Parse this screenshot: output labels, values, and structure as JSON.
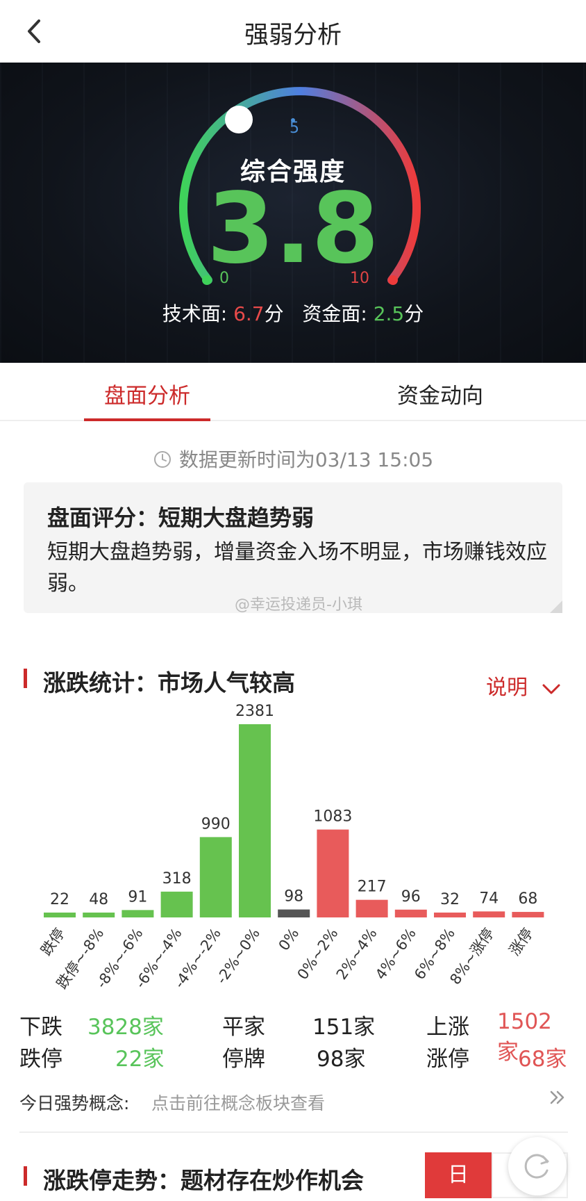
{
  "header": {
    "title": "强弱分析"
  },
  "gauge": {
    "label": "综合强度",
    "value": "3.8",
    "min_label": "0",
    "max_label": "10",
    "mid_label": "5",
    "level": 0.38,
    "technical_label": "技术面: ",
    "technical_value": "6.7",
    "funds_label": "资金面: ",
    "funds_value": "2.5",
    "unit": "分",
    "colors": {
      "low": "#3fd25a",
      "mid": "#4f7fe0",
      "high": "#ee3b3b"
    }
  },
  "tabs": [
    {
      "label": "盘面分析",
      "active": true
    },
    {
      "label": "资金动向",
      "active": false
    }
  ],
  "update": {
    "text": "数据更新时间为03/13  15:05"
  },
  "summary": {
    "title": "盘面评分：短期大盘趋势弱",
    "body": "短期大盘趋势弱，增量资金入场不明显，市场赚钱效应弱。"
  },
  "watermark": "@幸运投递员-小琪",
  "stats_section": {
    "title": "涨跌统计：市场人气较高",
    "explain_label": "说明"
  },
  "chart_data": {
    "type": "bar",
    "categories": [
      "跌停",
      "跌停~-8%",
      "-8%~-6%",
      "-6%~-4%",
      "-4%~-2%",
      "-2%~0%",
      "0%",
      "0%~2%",
      "2%~4%",
      "4%~6%",
      "6%~8%",
      "8%~涨停",
      "涨停"
    ],
    "values": [
      22,
      48,
      91,
      318,
      990,
      2381,
      98,
      1083,
      217,
      96,
      32,
      74,
      68
    ],
    "colors": [
      "#66c24f",
      "#66c24f",
      "#66c24f",
      "#66c24f",
      "#66c24f",
      "#66c24f",
      "#555555",
      "#e85b5b",
      "#e85b5b",
      "#e85b5b",
      "#e85b5b",
      "#e85b5b",
      "#e85b5b"
    ],
    "title": "",
    "xlabel": "",
    "ylabel": ""
  },
  "stats": {
    "down_label": "下跌",
    "down_value": "3828家",
    "flat_label": "平家",
    "flat_value": "151家",
    "up_label": "上涨",
    "up_value": "1502家",
    "limit_down_label": "跌停",
    "limit_down_value": "22家",
    "suspended_label": "停牌",
    "suspended_value": "98家",
    "limit_up_label": "涨停",
    "limit_up_value": "68家"
  },
  "concept": {
    "label": "今日强势概念:",
    "link": "点击前往概念板块查看"
  },
  "trend_section": {
    "title": "涨跌停走势：题材存在炒作机会",
    "day_label": "日"
  }
}
